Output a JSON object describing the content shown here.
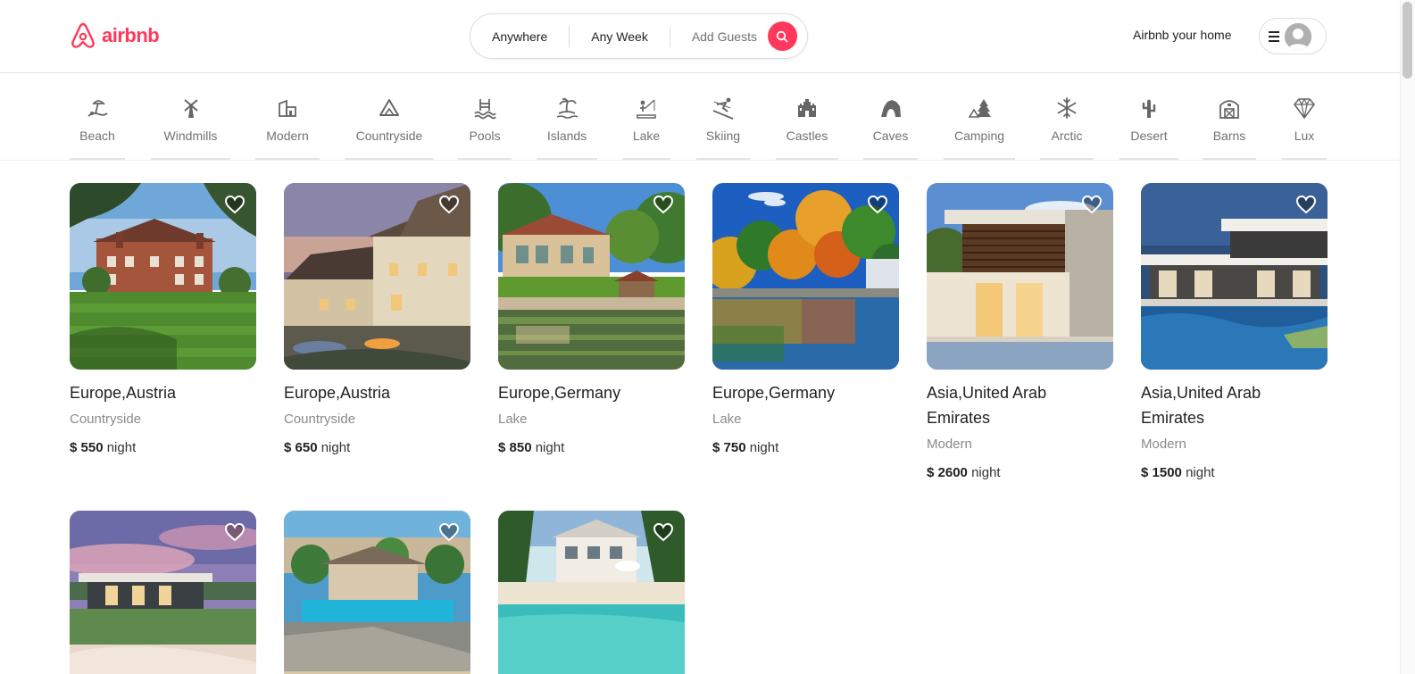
{
  "brand": {
    "name": "airbnb",
    "color": "#ff385c"
  },
  "search": {
    "where": "Anywhere",
    "when": "Any Week",
    "guests": "Add Guests"
  },
  "header": {
    "host_link": "Airbnb your home"
  },
  "categories": [
    {
      "label": "Beach",
      "icon": "beach-icon"
    },
    {
      "label": "Windmills",
      "icon": "windmill-icon"
    },
    {
      "label": "Modern",
      "icon": "modern-house-icon"
    },
    {
      "label": "Countryside",
      "icon": "mountain-icon"
    },
    {
      "label": "Pools",
      "icon": "pool-icon"
    },
    {
      "label": "Islands",
      "icon": "island-icon"
    },
    {
      "label": "Lake",
      "icon": "lake-icon"
    },
    {
      "label": "Skiing",
      "icon": "skiing-icon"
    },
    {
      "label": "Castles",
      "icon": "castle-icon"
    },
    {
      "label": "Caves",
      "icon": "cave-icon"
    },
    {
      "label": "Camping",
      "icon": "camping-icon"
    },
    {
      "label": "Arctic",
      "icon": "snowflake-icon"
    },
    {
      "label": "Desert",
      "icon": "cactus-icon"
    },
    {
      "label": "Barns",
      "icon": "barn-icon"
    },
    {
      "label": "Lux",
      "icon": "diamond-icon"
    }
  ],
  "listings": [
    {
      "location": "Europe,Austria",
      "category": "Countryside",
      "price": "$ 550",
      "unit": "night"
    },
    {
      "location": "Europe,Austria",
      "category": "Countryside",
      "price": "$ 650",
      "unit": "night"
    },
    {
      "location": "Europe,Germany",
      "category": "Lake",
      "price": "$ 850",
      "unit": "night"
    },
    {
      "location": "Europe,Germany",
      "category": "Lake",
      "price": "$ 750",
      "unit": "night"
    },
    {
      "location": "Asia,United Arab Emirates",
      "category": "Modern",
      "price": "$ 2600",
      "unit": "night"
    },
    {
      "location": "Asia,United Arab Emirates",
      "category": "Modern",
      "price": "$ 1500",
      "unit": "night"
    },
    {
      "location": "",
      "category": "",
      "price": "",
      "unit": ""
    },
    {
      "location": "",
      "category": "",
      "price": "",
      "unit": ""
    },
    {
      "location": "",
      "category": "",
      "price": "",
      "unit": ""
    }
  ]
}
